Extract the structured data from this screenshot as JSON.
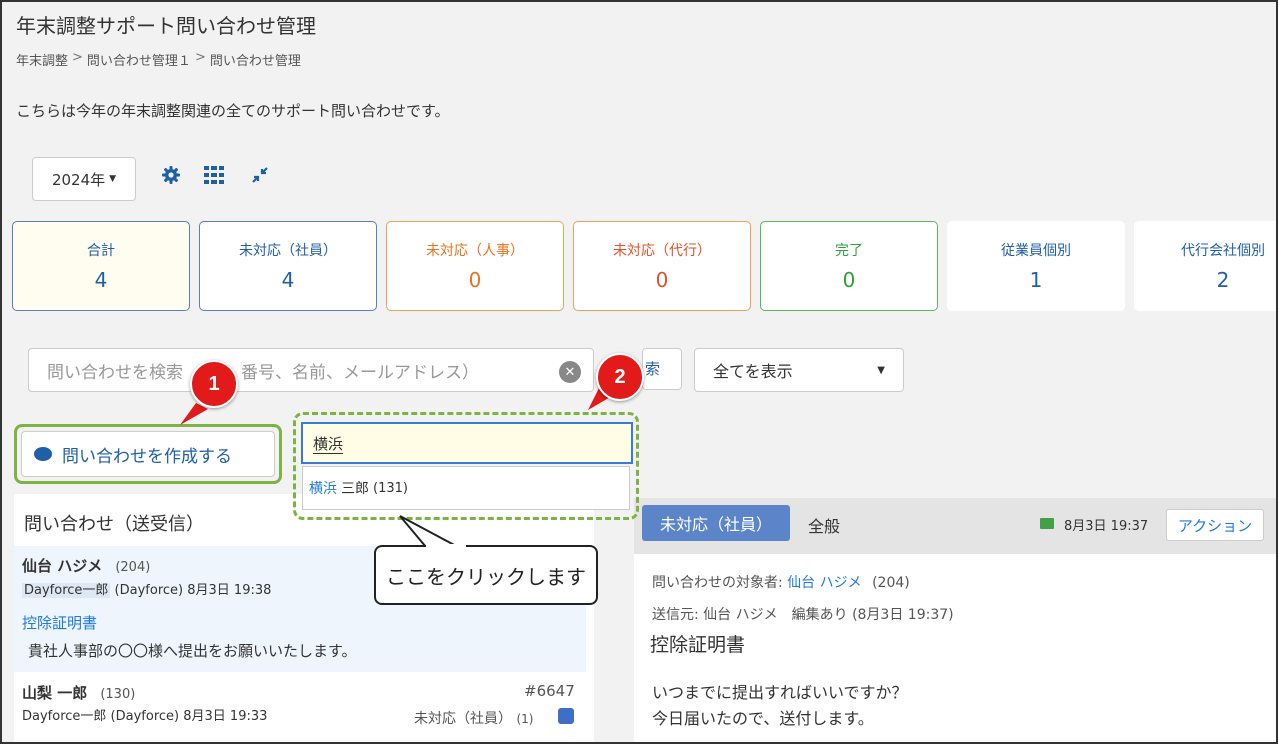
{
  "page": {
    "title": "年末調整サポート問い合わせ管理",
    "breadcrumb": [
      "年末調整",
      "問い合わせ管理１",
      "問い合わせ管理"
    ],
    "breadcrumb_sep": ">",
    "description": "こちらは今年の年末調整関連の全てのサポート問い合わせです。"
  },
  "toolbar": {
    "year": "2024年",
    "icons": [
      "gear-icon",
      "grid-icon",
      "collapse-icon"
    ]
  },
  "cards": [
    {
      "label": "合計",
      "count": "4",
      "border": "#5a7fc0",
      "label_color": "#1f5fa8",
      "bg": "#fffdf0"
    },
    {
      "label": "未対応（社員）",
      "count": "4",
      "border": "#5a7fc0",
      "label_color": "#1f5fa8",
      "bg": "#ffffff"
    },
    {
      "label": "未対応（人事）",
      "count": "0",
      "border": "#f0a060",
      "label_color": "#e8741f",
      "bg": "#ffffff"
    },
    {
      "label": "未対応（代行）",
      "count": "0",
      "border": "#f0a060",
      "label_color": "#e0522a",
      "bg": "#ffffff"
    },
    {
      "label": "完了",
      "count": "0",
      "border": "#5cb85c",
      "label_color": "#2e9e3e",
      "bg": "#ffffff"
    },
    {
      "label": "従業員個別",
      "count": "1",
      "border": "#ffffff",
      "label_color": "#1f5fa8",
      "bg": "#ffffff"
    },
    {
      "label": "代行会社個別",
      "count": "2",
      "border": "#ffffff",
      "label_color": "#1f5fa8",
      "bg": "#ffffff"
    }
  ],
  "search": {
    "placeholder_a": "問い合わせを検索",
    "placeholder_b": "番号、名前、メールアドレス）",
    "button_partial": "索",
    "filter": "全てを表示"
  },
  "create_button": "問い合わせを作成する",
  "autocomplete": {
    "value": "横浜",
    "option_highlight": "横浜",
    "option_rest": "三郎",
    "option_id": "(131)"
  },
  "annotations": {
    "badge1": "1",
    "badge2": "2",
    "callout": "ここをクリックします"
  },
  "list": {
    "header": "問い合わせ（送受信）",
    "items": [
      {
        "name": "仙台 ハジメ",
        "id": "(204)",
        "tag": "Dayforce一郎",
        "company": "(Dayforce)",
        "time": "8月3日 19:38",
        "subject": "控除証明書",
        "body": "貴社人事部の〇〇様へ提出をお願いいたします。"
      },
      {
        "name": "山梨 一郎",
        "id": "(130)",
        "tag": "Dayforce一郎",
        "company": "(Dayforce)",
        "time": "8月3日 19:33",
        "number": "#6647",
        "status": "未対応（社員）",
        "status_count": "(1)"
      }
    ]
  },
  "detail": {
    "status": "未対応（社員）",
    "category": "全般",
    "mail_time": "8月3日 19:37",
    "action": "アクション",
    "target_label": "問い合わせの対象者:",
    "target_name": "仙台 ハジメ",
    "target_id": "(204)",
    "sender_line": "送信元: 仙台 ハジメ　編集あり (8月3日 19:37)",
    "subject": "控除証明書",
    "body_lines": [
      "いつまでに提出すればいいですか？",
      "今日届いたので、送付します。"
    ]
  }
}
